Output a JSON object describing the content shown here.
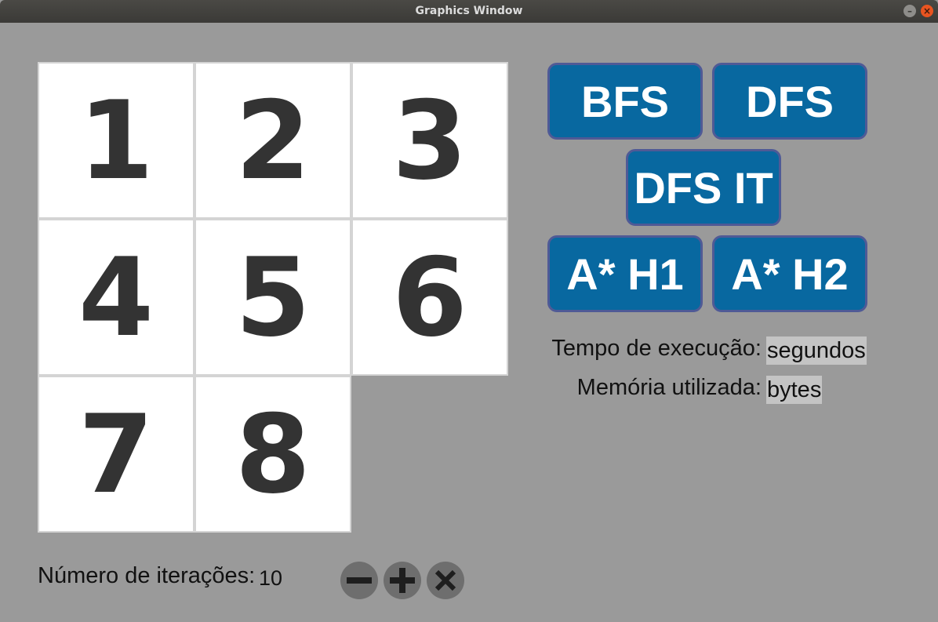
{
  "window": {
    "title": "Graphics Window"
  },
  "board": {
    "tiles": [
      "1",
      "2",
      "3",
      "4",
      "5",
      "6",
      "7",
      "8"
    ]
  },
  "buttons": {
    "bfs": "BFS",
    "dfs": "DFS",
    "dfs_it": "DFS IT",
    "astar_h1": "A* H1",
    "astar_h2": "A* H2"
  },
  "stats": {
    "time_label": "Tempo de execução:",
    "time_value": "segundos",
    "memory_label": "Memória utilizada:",
    "memory_value": "bytes"
  },
  "iterations": {
    "label": "Número de iterações:",
    "value": "10"
  },
  "icons": {
    "decrement": "minus-icon",
    "increment": "plus-icon",
    "reset": "close-x-icon",
    "window_minimize": "minimize-icon",
    "window_close": "close-icon"
  },
  "colors": {
    "background": "#9a9a9a",
    "button": "#0868a0",
    "button_border": "#4f5a96",
    "tile": "#ffffff",
    "tile_text": "#333333"
  }
}
